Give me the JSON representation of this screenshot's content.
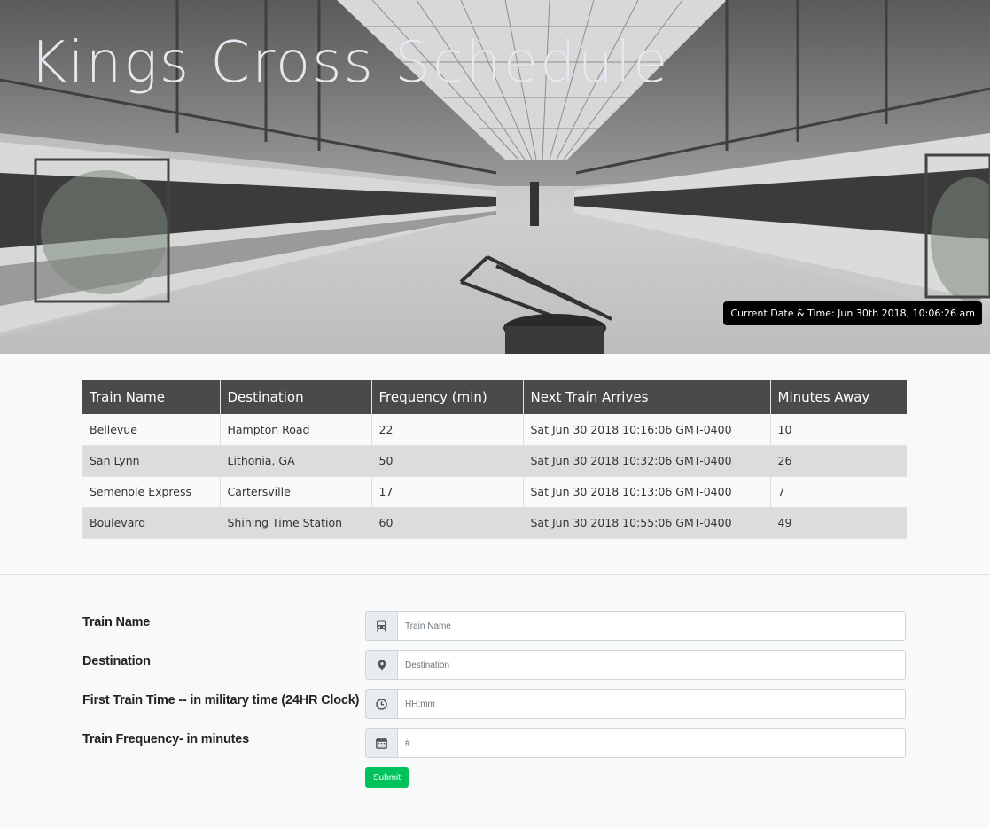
{
  "hero": {
    "title": "Kings Cross Schedule",
    "clock_text": "Current Date & Time: Jun 30th 2018, 10:06:26 am"
  },
  "table": {
    "headers": [
      "Train Name",
      "Destination",
      "Frequency (min)",
      "Next Train Arrives",
      "Minutes Away"
    ],
    "rows": [
      [
        "Bellevue",
        "Hampton Road",
        "22",
        "Sat Jun 30 2018 10:16:06 GMT-0400",
        "10"
      ],
      [
        "San Lynn",
        "Lithonia, GA",
        "50",
        "Sat Jun 30 2018 10:32:06 GMT-0400",
        "26"
      ],
      [
        "Semenole Express",
        "Cartersville",
        "17",
        "Sat Jun 30 2018 10:13:06 GMT-0400",
        "7"
      ],
      [
        "Boulevard",
        "Shining Time Station",
        "60",
        "Sat Jun 30 2018 10:55:06 GMT-0400",
        "49"
      ]
    ]
  },
  "form": {
    "fields": [
      {
        "label": "Train Name",
        "placeholder": "Train Name",
        "icon": "train-icon"
      },
      {
        "label": "Destination",
        "placeholder": "Destination",
        "icon": "map-marker-icon"
      },
      {
        "label": "First Train Time -- in military time (24HR Clock)",
        "placeholder": "HH:mm",
        "icon": "clock-icon"
      },
      {
        "label": "Train Frequency- in minutes",
        "placeholder": "#",
        "icon": "calendar-icon"
      }
    ],
    "submit_label": "Submit"
  },
  "colors": {
    "table_header": "#4b4a4a",
    "row_alt": "#dcdcdc",
    "submit": "#00c15a",
    "title": "#e4e8ef"
  }
}
